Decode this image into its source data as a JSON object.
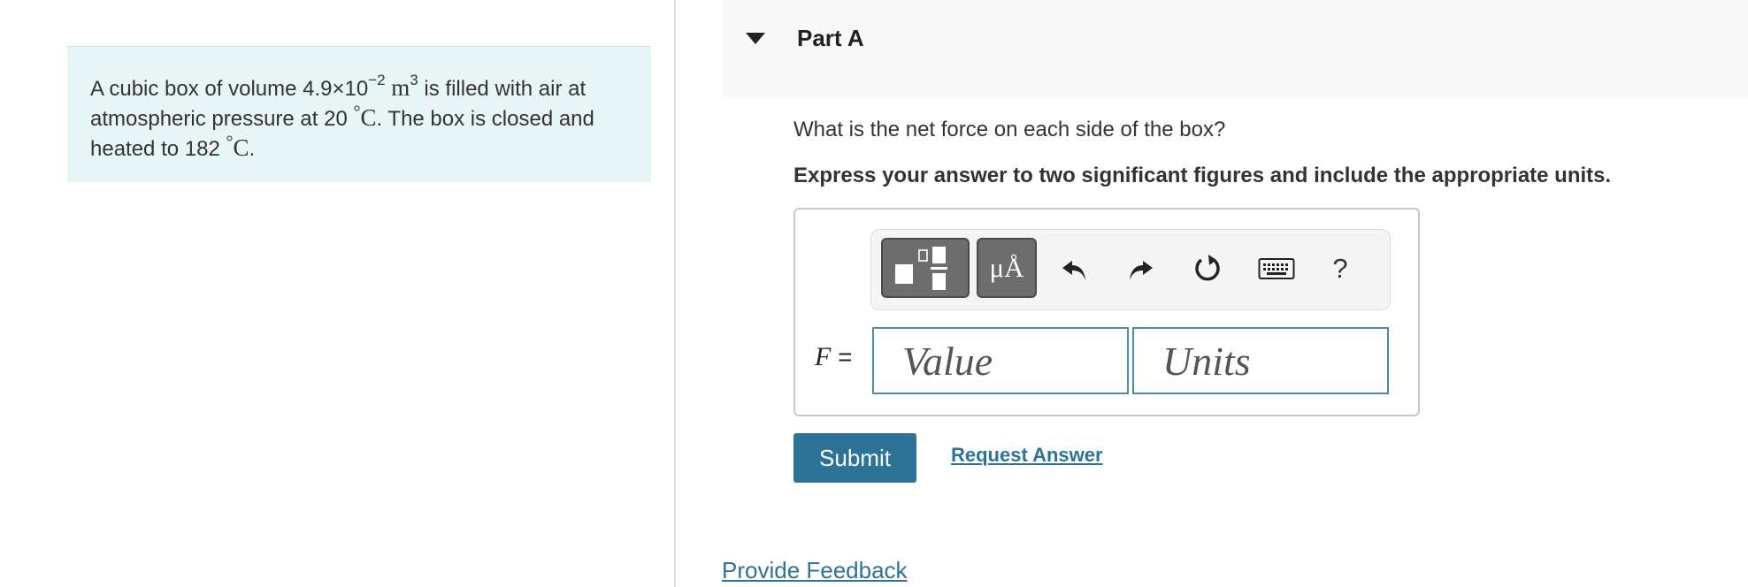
{
  "problem": {
    "text_1": "A cubic box of volume 4.9×10",
    "exponent": "−2",
    "unit_m": "m",
    "unit_exp": "3",
    "text_2": " is filled with air at atmospheric pressure at 20 ",
    "deg_1": "°",
    "unit_c1": "C",
    "text_3": ". The box is closed and heated to 182 ",
    "deg_2": "°",
    "unit_c2": "C",
    "text_4": "."
  },
  "part": {
    "title": "Part A",
    "question": "What is the net force on each side of the box?",
    "instruction": "Express your answer to two significant figures and include the appropriate units."
  },
  "toolbar": {
    "units_label": "μÅ",
    "help_label": "?"
  },
  "answer": {
    "variable": "F",
    "equals": "=",
    "value_placeholder": "Value",
    "units_placeholder": "Units"
  },
  "actions": {
    "submit_label": "Submit",
    "request_label": "Request Answer",
    "feedback_label": "Provide Feedback"
  },
  "colors": {
    "accent": "#2d7397",
    "problem_bg": "#e8f5f7",
    "field_border": "#4c8aa2"
  },
  "icons": [
    "caret-down-icon",
    "templates-icon",
    "undo-icon",
    "redo-icon",
    "reset-icon",
    "keyboard-icon",
    "help-icon"
  ]
}
